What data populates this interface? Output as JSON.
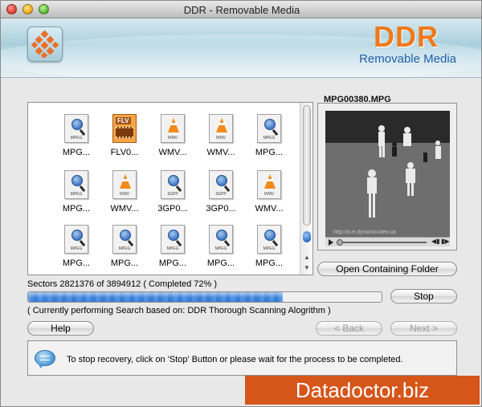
{
  "window": {
    "title": "DDR - Removable Media"
  },
  "header": {
    "brand": "DDR",
    "subtitle": "Removable Media"
  },
  "files": [
    {
      "label": "MPG...",
      "type": "mpeg",
      "fmt": "MPEG"
    },
    {
      "label": "FLV0...",
      "type": "flv",
      "fmt": "FLV"
    },
    {
      "label": "WMV...",
      "type": "wmv",
      "fmt": "WMV"
    },
    {
      "label": "WMV...",
      "type": "wmv",
      "fmt": "WMV"
    },
    {
      "label": "MPG...",
      "type": "mpeg",
      "fmt": "MPEG"
    },
    {
      "label": "MPG...",
      "type": "mpeg",
      "fmt": "MPEG"
    },
    {
      "label": "WMV...",
      "type": "wmv",
      "fmt": "WMV"
    },
    {
      "label": "3GP0...",
      "type": "3gp",
      "fmt": "3GPP"
    },
    {
      "label": "3GP0...",
      "type": "3gp",
      "fmt": "3GPP"
    },
    {
      "label": "WMV...",
      "type": "wmv",
      "fmt": "WMV"
    },
    {
      "label": "MPG...",
      "type": "mpeg",
      "fmt": "MPEG"
    },
    {
      "label": "MPG...",
      "type": "mpeg",
      "fmt": "MPEG"
    },
    {
      "label": "MPG...",
      "type": "mpeg",
      "fmt": "MPEG"
    },
    {
      "label": "MPG...",
      "type": "mpeg",
      "fmt": "MPEG"
    },
    {
      "label": "MPG...",
      "type": "mpeg",
      "fmt": "MPEG"
    }
  ],
  "preview": {
    "filename": "MPG00380.MPG",
    "watermark": "http://o.e.dynamo.kiev.ua"
  },
  "buttons": {
    "open_folder": "Open Containing Folder",
    "stop": "Stop",
    "help": "Help",
    "back": "< Back",
    "next": "Next >"
  },
  "progress": {
    "sectors_text": "Sectors 2821376 of 3894912    ( Completed 72% )",
    "percent": 72,
    "scan_note": "( Currently performing Search based on: DDR Thorough Scanning Alogrithm )"
  },
  "info": {
    "message": "To stop recovery, click on 'Stop' Button or please wait for the process to be completed."
  },
  "footer": {
    "site": "Datadoctor.biz"
  },
  "colors": {
    "brand": "#ee7a1c",
    "subtitle": "#1f5fa8",
    "badge": "#d6561a",
    "progress": "#4d8fe0"
  }
}
